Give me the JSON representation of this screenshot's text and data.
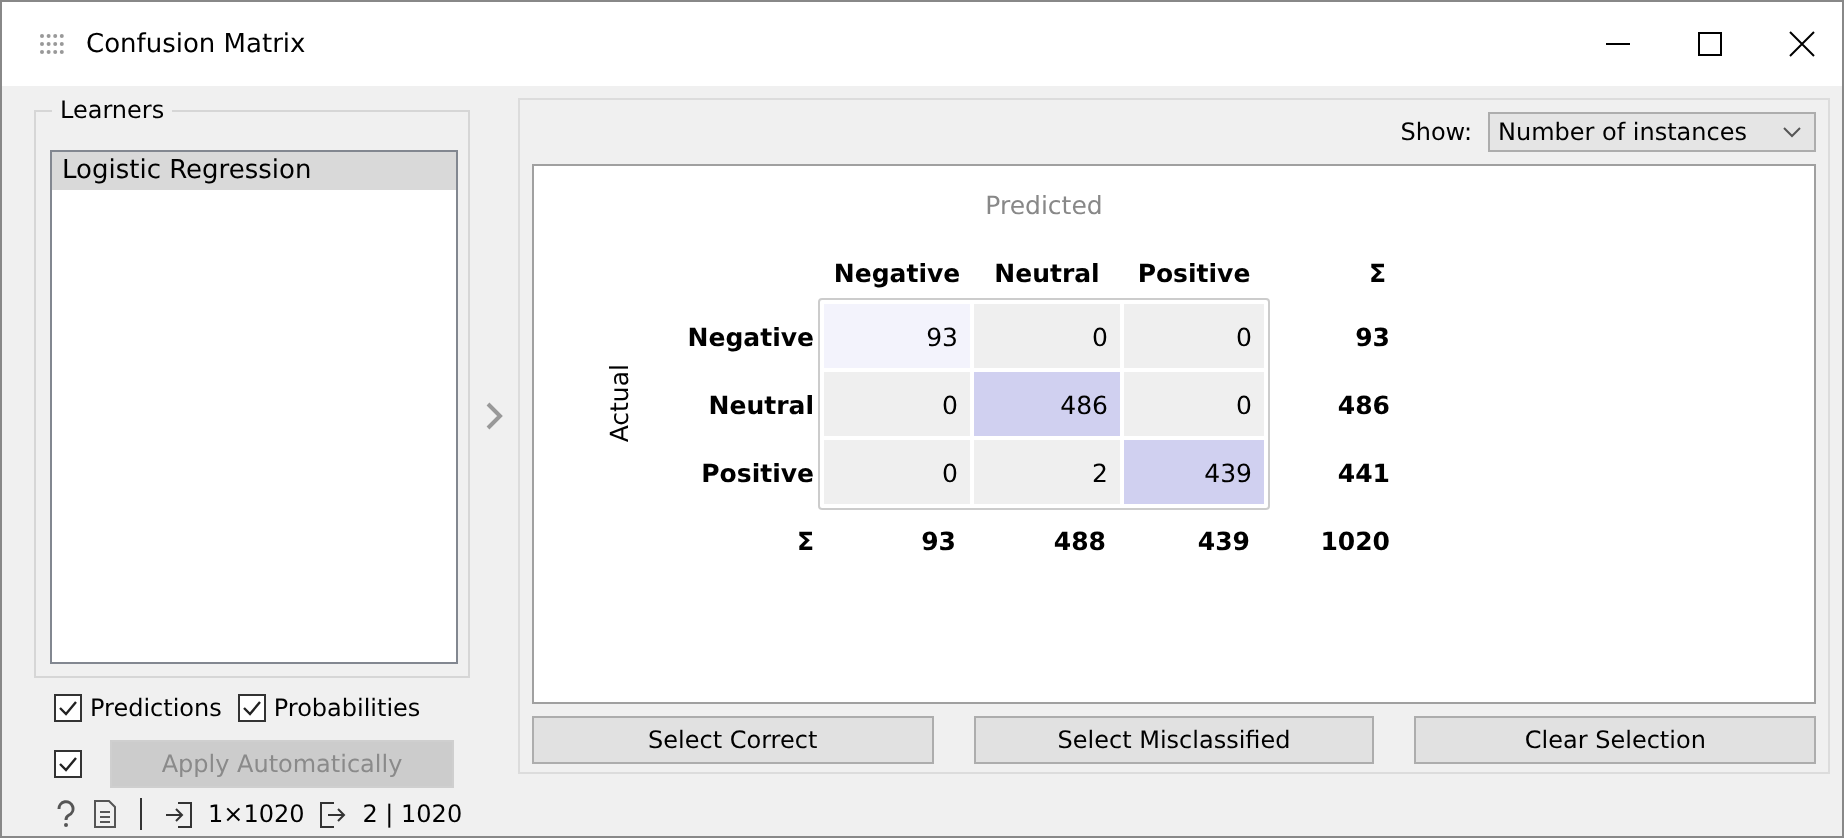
{
  "window": {
    "title": "Confusion Matrix"
  },
  "learners": {
    "title": "Learners",
    "items": [
      {
        "label": "Logistic Regression",
        "selected": true
      }
    ]
  },
  "options": [
    {
      "label": "Predictions",
      "checked": true
    },
    {
      "label": "Probabilities",
      "checked": true
    }
  ],
  "apply": {
    "checked": true,
    "label": "Apply Automatically",
    "disabled": true
  },
  "show": {
    "label": "Show:",
    "value": "Number of instances"
  },
  "matrix": {
    "predicted_label": "Predicted",
    "actual_label": "Actual",
    "sum_symbol": "Σ",
    "row_sum_symbol": "Σ",
    "columns": [
      "Negative",
      "Neutral",
      "Positive"
    ],
    "rows": [
      {
        "label": "Negative",
        "cells": [
          {
            "value": "93",
            "color": "#f3f3fc"
          },
          {
            "value": "0",
            "color": "#efefef"
          },
          {
            "value": "0",
            "color": "#efefef"
          }
        ],
        "total": "93"
      },
      {
        "label": "Neutral",
        "cells": [
          {
            "value": "0",
            "color": "#efefef"
          },
          {
            "value": "486",
            "color": "#d0d0f0"
          },
          {
            "value": "0",
            "color": "#efefef"
          }
        ],
        "total": "486"
      },
      {
        "label": "Positive",
        "cells": [
          {
            "value": "0",
            "color": "#efefef"
          },
          {
            "value": "2",
            "color": "#efefef"
          },
          {
            "value": "439",
            "color": "#d0d0f0"
          }
        ],
        "total": "441"
      }
    ],
    "column_totals": [
      "93",
      "488",
      "439"
    ],
    "grand_total": "1020"
  },
  "buttons": [
    "Select Correct",
    "Select Misclassified",
    "Clear Selection"
  ],
  "status_bar": {
    "input": "1×1020",
    "output": "2 | 1020"
  }
}
